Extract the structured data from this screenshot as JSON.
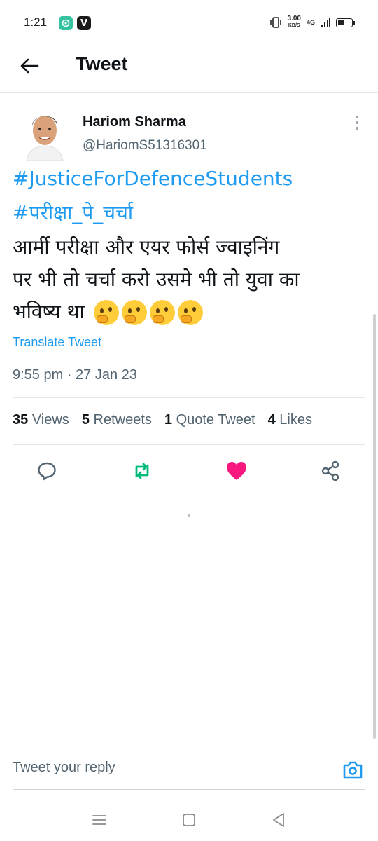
{
  "status_bar": {
    "time": "1:21",
    "net_speed": "3.00",
    "net_unit": "KB/S",
    "network": "4G",
    "battery_level": 0.6
  },
  "header": {
    "title": "Tweet"
  },
  "tweet": {
    "author_name": "Hariom Sharma",
    "author_handle": "@HariomS51316301",
    "hashtags": [
      "#JusticeForDefenceStudents",
      "#परीक्षा_पे_चर्चा"
    ],
    "body_line1": "आर्मी परीक्षा और एयर फोर्स ज्वाइनिंग",
    "body_line2": "पर भी तो चर्चा करो उसमे भी तो युवा का",
    "body_line3": "भविष्य था",
    "emojis": [
      "thinking-face",
      "thinking-face",
      "thinking-face",
      "thinking-face"
    ],
    "translate_label": "Translate Tweet",
    "timestamp": "9:55 pm · 27 Jan 23"
  },
  "stats": [
    {
      "count": "35",
      "label": "Views"
    },
    {
      "count": "5",
      "label": "Retweets"
    },
    {
      "count": "1",
      "label": "Quote Tweet"
    },
    {
      "count": "4",
      "label": "Likes"
    }
  ],
  "actions": {
    "icons": [
      "reply-icon",
      "retweet-icon",
      "like-icon",
      "share-icon"
    ],
    "retweet_color": "#00ba7c",
    "like_color": "#f91880"
  },
  "reply": {
    "placeholder": "Tweet your reply"
  },
  "colors": {
    "accent": "#1d9bf0",
    "text": "#0f1419",
    "secondary": "#536471"
  }
}
